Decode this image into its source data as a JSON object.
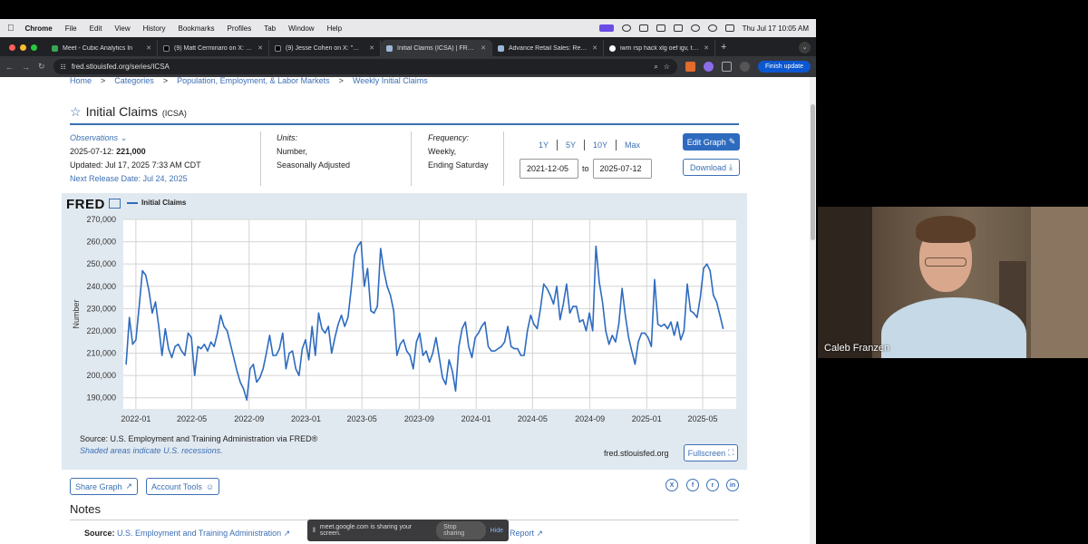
{
  "menubar": {
    "app": "Chrome",
    "items": [
      "File",
      "Edit",
      "View",
      "History",
      "Bookmarks",
      "Profiles",
      "Tab",
      "Window",
      "Help"
    ],
    "datetime": "Thu Jul 17  10:05 AM"
  },
  "tabs": [
    {
      "title": "Meet - Cubic Analytics In",
      "active": false
    },
    {
      "title": "(9) Matt Cerminaro on X: \"Se",
      "active": false
    },
    {
      "title": "(9) Jesse Cohen on X: \"❗ Ju",
      "active": false
    },
    {
      "title": "Initial Claims (ICSA) | FRED | S",
      "active": true
    },
    {
      "title": "Advance Retail Sales: Retail T",
      "active": false
    },
    {
      "title": "iwm rsp hack xlg oef igv, tota",
      "active": false
    }
  ],
  "browser": {
    "url": "fred.stlouisfed.org/series/ICSA",
    "finish_update": "Finish update"
  },
  "breadcrumb": [
    "Home",
    "Categories",
    "Population, Employment, & Labor Markets",
    "Weekly Initial Claims"
  ],
  "series": {
    "title": "Initial Claims",
    "code": "(ICSA)",
    "observations_label": "Observations",
    "obs_date": "2025-07-12:",
    "obs_value": "221,000",
    "updated": "Updated: Jul 17, 2025 7:33 AM CDT",
    "next_release": "Next Release Date: Jul 24, 2025",
    "units_label": "Units:",
    "units_1": "Number,",
    "units_2": "Seasonally Adjusted",
    "frequency_label": "Frequency:",
    "frequency_1": "Weekly,",
    "frequency_2": "Ending Saturday"
  },
  "ranges": [
    "1Y",
    "5Y",
    "10Y",
    "Max"
  ],
  "dates": {
    "from": "2021-12-05",
    "to_label": "to",
    "to": "2025-07-12"
  },
  "buttons": {
    "edit_graph": "Edit Graph",
    "download": "Download",
    "fullscreen": "Fullscreen",
    "share_graph": "Share Graph",
    "account_tools": "Account Tools"
  },
  "chart_data": {
    "type": "line",
    "legend": "Initial Claims",
    "ylabel": "Number",
    "ylim": [
      185000,
      270000
    ],
    "y_ticks": [
      "270,000",
      "260,000",
      "250,000",
      "240,000",
      "230,000",
      "220,000",
      "210,000",
      "200,000",
      "190,000"
    ],
    "x_ticks": [
      "2022-01",
      "2022-05",
      "2022-09",
      "2023-01",
      "2023-05",
      "2023-09",
      "2024-01",
      "2024-05",
      "2024-09",
      "2025-01",
      "2025-05"
    ],
    "x_range": [
      "2021-12-05",
      "2025-07-12"
    ],
    "series": [
      {
        "name": "Initial Claims",
        "color": "#2e6bbf",
        "points": [
          [
            "2021-12-11",
            205000
          ],
          [
            "2021-12-18",
            226000
          ],
          [
            "2021-12-25",
            214000
          ],
          [
            "2022-01-01",
            216000
          ],
          [
            "2022-01-08",
            231000
          ],
          [
            "2022-01-15",
            247000
          ],
          [
            "2022-01-22",
            245000
          ],
          [
            "2022-01-29",
            238000
          ],
          [
            "2022-02-05",
            228000
          ],
          [
            "2022-02-12",
            233000
          ],
          [
            "2022-02-19",
            222000
          ],
          [
            "2022-02-26",
            209000
          ],
          [
            "2022-03-05",
            221000
          ],
          [
            "2022-03-12",
            212000
          ],
          [
            "2022-03-19",
            208000
          ],
          [
            "2022-03-26",
            213000
          ],
          [
            "2022-04-02",
            214000
          ],
          [
            "2022-04-09",
            211000
          ],
          [
            "2022-04-16",
            209000
          ],
          [
            "2022-04-23",
            219000
          ],
          [
            "2022-04-30",
            217000
          ],
          [
            "2022-05-07",
            200000
          ],
          [
            "2022-05-14",
            213000
          ],
          [
            "2022-05-21",
            212000
          ],
          [
            "2022-05-28",
            214000
          ],
          [
            "2022-06-04",
            211000
          ],
          [
            "2022-06-11",
            215000
          ],
          [
            "2022-06-18",
            213000
          ],
          [
            "2022-06-25",
            219000
          ],
          [
            "2022-07-02",
            227000
          ],
          [
            "2022-07-09",
            222000
          ],
          [
            "2022-07-16",
            220000
          ],
          [
            "2022-07-23",
            214000
          ],
          [
            "2022-07-30",
            208000
          ],
          [
            "2022-08-06",
            202000
          ],
          [
            "2022-08-13",
            197000
          ],
          [
            "2022-08-20",
            194000
          ],
          [
            "2022-08-27",
            189000
          ],
          [
            "2022-09-03",
            203000
          ],
          [
            "2022-09-10",
            205000
          ],
          [
            "2022-09-17",
            197000
          ],
          [
            "2022-09-24",
            199000
          ],
          [
            "2022-10-01",
            203000
          ],
          [
            "2022-10-08",
            210000
          ],
          [
            "2022-10-15",
            218000
          ],
          [
            "2022-10-22",
            209000
          ],
          [
            "2022-10-29",
            209000
          ],
          [
            "2022-11-05",
            212000
          ],
          [
            "2022-11-12",
            219000
          ],
          [
            "2022-11-19",
            203000
          ],
          [
            "2022-11-26",
            210000
          ],
          [
            "2022-12-03",
            211000
          ],
          [
            "2022-12-10",
            203000
          ],
          [
            "2022-12-17",
            200000
          ],
          [
            "2022-12-24",
            212000
          ],
          [
            "2022-12-31",
            216000
          ],
          [
            "2023-01-07",
            207000
          ],
          [
            "2023-01-14",
            222000
          ],
          [
            "2023-01-21",
            209000
          ],
          [
            "2023-01-28",
            228000
          ],
          [
            "2023-02-04",
            221000
          ],
          [
            "2023-02-11",
            219000
          ],
          [
            "2023-02-18",
            222000
          ],
          [
            "2023-02-25",
            210000
          ],
          [
            "2023-03-04",
            217000
          ],
          [
            "2023-03-11",
            223000
          ],
          [
            "2023-03-18",
            227000
          ],
          [
            "2023-03-25",
            222000
          ],
          [
            "2023-04-01",
            226000
          ],
          [
            "2023-04-08",
            239000
          ],
          [
            "2023-04-15",
            254000
          ],
          [
            "2023-04-22",
            258000
          ],
          [
            "2023-04-29",
            260000
          ],
          [
            "2023-05-06",
            240000
          ],
          [
            "2023-05-13",
            248000
          ],
          [
            "2023-05-20",
            229000
          ],
          [
            "2023-05-27",
            228000
          ],
          [
            "2023-06-03",
            231000
          ],
          [
            "2023-06-10",
            257000
          ],
          [
            "2023-06-17",
            247000
          ],
          [
            "2023-06-24",
            240000
          ],
          [
            "2023-07-01",
            236000
          ],
          [
            "2023-07-08",
            229000
          ],
          [
            "2023-07-15",
            209000
          ],
          [
            "2023-07-22",
            214000
          ],
          [
            "2023-07-29",
            216000
          ],
          [
            "2023-08-05",
            211000
          ],
          [
            "2023-08-12",
            209000
          ],
          [
            "2023-08-19",
            203000
          ],
          [
            "2023-08-26",
            215000
          ],
          [
            "2023-09-02",
            219000
          ],
          [
            "2023-09-09",
            209000
          ],
          [
            "2023-09-16",
            211000
          ],
          [
            "2023-09-23",
            206000
          ],
          [
            "2023-09-30",
            210000
          ],
          [
            "2023-10-07",
            217000
          ],
          [
            "2023-10-14",
            208000
          ],
          [
            "2023-10-21",
            199000
          ],
          [
            "2023-10-28",
            196000
          ],
          [
            "2023-11-04",
            207000
          ],
          [
            "2023-11-11",
            202000
          ],
          [
            "2023-11-18",
            193000
          ],
          [
            "2023-11-25",
            213000
          ],
          [
            "2023-12-02",
            221000
          ],
          [
            "2023-12-09",
            224000
          ],
          [
            "2023-12-16",
            213000
          ],
          [
            "2023-12-23",
            208000
          ],
          [
            "2023-12-30",
            217000
          ],
          [
            "2024-01-06",
            219000
          ],
          [
            "2024-01-13",
            222000
          ],
          [
            "2024-01-20",
            224000
          ],
          [
            "2024-01-27",
            213000
          ],
          [
            "2024-02-03",
            211000
          ],
          [
            "2024-02-10",
            211000
          ],
          [
            "2024-02-17",
            212000
          ],
          [
            "2024-02-24",
            213000
          ],
          [
            "2024-03-02",
            215000
          ],
          [
            "2024-03-09",
            222000
          ],
          [
            "2024-03-16",
            213000
          ],
          [
            "2024-03-23",
            212000
          ],
          [
            "2024-03-30",
            212000
          ],
          [
            "2024-04-06",
            209000
          ],
          [
            "2024-04-13",
            209000
          ],
          [
            "2024-04-20",
            220000
          ],
          [
            "2024-04-27",
            227000
          ],
          [
            "2024-05-04",
            223000
          ],
          [
            "2024-05-11",
            221000
          ],
          [
            "2024-05-18",
            230000
          ],
          [
            "2024-05-25",
            241000
          ],
          [
            "2024-06-01",
            239000
          ],
          [
            "2024-06-08",
            236000
          ],
          [
            "2024-06-15",
            232000
          ],
          [
            "2024-06-22",
            240000
          ],
          [
            "2024-06-29",
            225000
          ],
          [
            "2024-07-06",
            232000
          ],
          [
            "2024-07-13",
            241000
          ],
          [
            "2024-07-20",
            228000
          ],
          [
            "2024-07-27",
            231000
          ],
          [
            "2024-08-03",
            231000
          ],
          [
            "2024-08-10",
            224000
          ],
          [
            "2024-08-17",
            225000
          ],
          [
            "2024-08-24",
            220000
          ],
          [
            "2024-08-31",
            228000
          ],
          [
            "2024-09-07",
            220000
          ],
          [
            "2024-09-14",
            258000
          ],
          [
            "2024-09-21",
            242000
          ],
          [
            "2024-09-28",
            233000
          ],
          [
            "2024-10-05",
            220000
          ],
          [
            "2024-10-12",
            214000
          ],
          [
            "2024-10-19",
            218000
          ],
          [
            "2024-10-26",
            215000
          ],
          [
            "2024-11-02",
            223000
          ],
          [
            "2024-11-09",
            239000
          ],
          [
            "2024-11-16",
            227000
          ],
          [
            "2024-11-23",
            217000
          ],
          [
            "2024-11-30",
            211000
          ],
          [
            "2024-12-07",
            205000
          ],
          [
            "2024-12-14",
            215000
          ],
          [
            "2024-12-21",
            219000
          ],
          [
            "2024-12-28",
            219000
          ],
          [
            "2025-01-04",
            217000
          ],
          [
            "2025-01-11",
            213000
          ],
          [
            "2025-01-18",
            243000
          ],
          [
            "2025-01-25",
            223000
          ],
          [
            "2025-02-01",
            222000
          ],
          [
            "2025-02-08",
            223000
          ],
          [
            "2025-02-15",
            221000
          ],
          [
            "2025-02-22",
            224000
          ],
          [
            "2025-03-01",
            218000
          ],
          [
            "2025-03-08",
            224000
          ],
          [
            "2025-03-15",
            216000
          ],
          [
            "2025-03-22",
            220000
          ],
          [
            "2025-03-29",
            241000
          ],
          [
            "2025-04-05",
            229000
          ],
          [
            "2025-04-12",
            228000
          ],
          [
            "2025-04-19",
            226000
          ],
          [
            "2025-04-26",
            235000
          ],
          [
            "2025-05-03",
            248000
          ],
          [
            "2025-05-10",
            250000
          ],
          [
            "2025-05-17",
            247000
          ],
          [
            "2025-05-24",
            236000
          ],
          [
            "2025-05-31",
            233000
          ],
          [
            "2025-06-07",
            227000
          ],
          [
            "2025-06-14",
            221000
          ]
        ]
      }
    ]
  },
  "chart_text": {
    "source": "Source: U.S. Employment and Training Administration via FRED®",
    "recession_note": "Shaded areas indicate U.S. recessions.",
    "site": "fred.stlouisfed.org",
    "logo": "FRED"
  },
  "social": [
    "X",
    "f",
    "r",
    "in"
  ],
  "notes": {
    "heading": "Notes",
    "source_label": "Source:",
    "source_value": "U.S. Employment and Training Administration",
    "report": "Report"
  },
  "sharebar": {
    "text": "meet.google.com is sharing your screen.",
    "stop": "Stop sharing",
    "hide": "Hide"
  },
  "video": {
    "participant": "Caleb Franzen"
  }
}
